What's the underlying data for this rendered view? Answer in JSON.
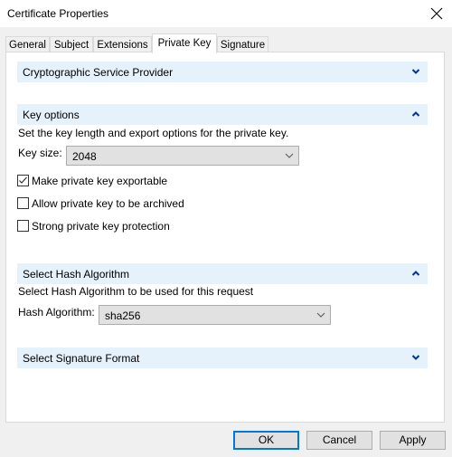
{
  "window": {
    "title": "Certificate Properties",
    "close_icon": "close-icon"
  },
  "tabs": [
    {
      "label": "General",
      "active": false
    },
    {
      "label": "Subject",
      "active": false
    },
    {
      "label": "Extensions",
      "active": false
    },
    {
      "label": "Private Key",
      "active": true
    },
    {
      "label": "Signature",
      "active": false
    }
  ],
  "sections": {
    "csp": {
      "title": "Cryptographic Service Provider",
      "expanded": false
    },
    "key_options": {
      "title": "Key options",
      "expanded": true,
      "description": "Set the key length and export options for the private key.",
      "key_size_label": "Key size:",
      "key_size_value": "2048",
      "checkboxes": [
        {
          "label": "Make private key exportable",
          "checked": true
        },
        {
          "label": "Allow private key to be archived",
          "checked": false
        },
        {
          "label": "Strong private key protection",
          "checked": false
        }
      ]
    },
    "hash": {
      "title": "Select Hash Algorithm",
      "expanded": true,
      "description": "Select Hash Algorithm to be used for this request",
      "label": "Hash Algorithm:",
      "value": "sha256"
    },
    "signature_format": {
      "title": "Select Signature Format",
      "expanded": false
    }
  },
  "buttons": {
    "ok": "OK",
    "cancel": "Cancel",
    "apply": "Apply"
  },
  "colors": {
    "section_header_bg": "#e5f1fb",
    "chevron": "#003399",
    "default_button_border": "#0078d7"
  }
}
